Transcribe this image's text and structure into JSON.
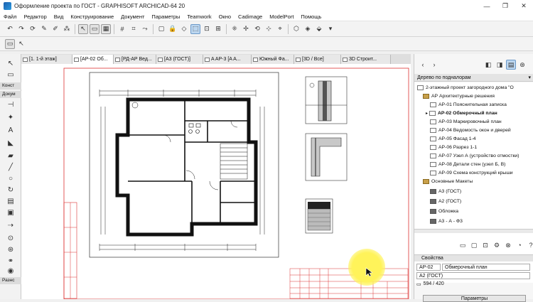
{
  "window": {
    "title": "Оформление проекта по ГОСТ - GRAPHISOFT ARCHICAD-64 20",
    "controls": [
      "—",
      "❐",
      "✕"
    ]
  },
  "menu": [
    "Файл",
    "Редактор",
    "Вид",
    "Конструирование",
    "Документ",
    "Параметры",
    "Teamwork",
    "Окно",
    "Cadimage",
    "ModelPort",
    "Помощь"
  ],
  "tabs": [
    {
      "label": "[1. 1-й этаж]"
    },
    {
      "label": "[АР-02 Об..."
    },
    {
      "label": "[РД-АР Вед..."
    },
    {
      "label": "[А3 (ГОСТ)]"
    },
    {
      "label": "A AP-3 [A A..."
    },
    {
      "label": "Южный Фа..."
    },
    {
      "label": "[3D / Все]"
    },
    {
      "label": "3D Строит..."
    }
  ],
  "left_panel": {
    "konstr": "Конст",
    "dokum": "Докум",
    "raznoe": "Разнс"
  },
  "navigator": {
    "header": "Дерево по подналорам",
    "items": [
      {
        "label": "2-этажный проект загородного дома \"О",
        "level": 0,
        "icon": "sheet"
      },
      {
        "label": "АР Архитектурные решения",
        "level": 1,
        "icon": "folder"
      },
      {
        "label": "АР-01 Пояснительная записка",
        "level": 2,
        "icon": "sheet"
      },
      {
        "label": "АР-02 Обмерочный план",
        "level": 2,
        "icon": "sheet",
        "bold": true
      },
      {
        "label": "АР-03 Маркировочный план",
        "level": 2,
        "icon": "sheet"
      },
      {
        "label": "АР-04 Ведомость окон и дверей",
        "level": 2,
        "icon": "sheet"
      },
      {
        "label": "АР-05 Фасад 1-4",
        "level": 2,
        "icon": "sheet"
      },
      {
        "label": "АР-06 Разрез 1-1",
        "level": 2,
        "icon": "sheet"
      },
      {
        "label": "АР-07 Узел А (устройство отмостки)",
        "level": 2,
        "icon": "sheet"
      },
      {
        "label": "АР-08 Детали стен (узел Б, В)",
        "level": 2,
        "icon": "sheet"
      },
      {
        "label": "АР-09 Схема конструкций крыши",
        "level": 2,
        "icon": "sheet"
      },
      {
        "label": "Основные Макеты",
        "level": 1,
        "icon": "folder"
      },
      {
        "label": "А3 (ГОСТ)",
        "level": 2,
        "icon": "dark"
      },
      {
        "label": "А2 (ГОСТ)",
        "level": 2,
        "icon": "dark"
      },
      {
        "label": "Обложка",
        "level": 2,
        "icon": "dark"
      },
      {
        "label": "А3 - А - Ф3",
        "level": 2,
        "icon": "dark"
      }
    ]
  },
  "properties": {
    "header": "Свойства",
    "id": "АР-02",
    "name": "Обмерочный план",
    "layout": "А2 (ГОСТ)",
    "size": "594 / 420",
    "params_button": "Параметры"
  }
}
